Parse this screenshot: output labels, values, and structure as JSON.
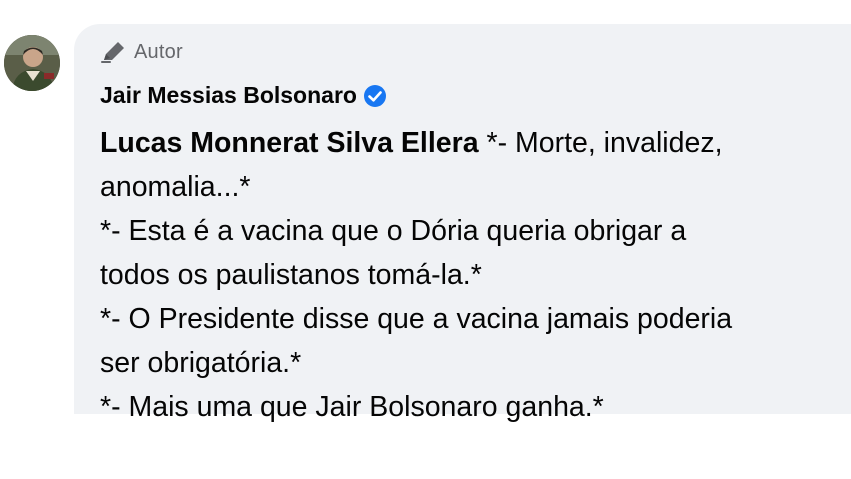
{
  "avatar": {
    "icon": "profile-photo"
  },
  "badge": {
    "label": "Autor",
    "icon": "pen-icon"
  },
  "author": {
    "name": "Jair Messias Bolsonaro",
    "verified": true,
    "verified_color": "#1877f2"
  },
  "comment": {
    "mention": "Lucas Monnerat Silva Ellera",
    "lines": [
      " *- Morte, invalidez,",
      "anomalia...*",
      "*- Esta é a vacina que o Dória queria obrigar a",
      "todos os paulistanos tomá-la.*",
      "*- O Presidente disse que a vacina jamais poderia",
      "ser obrigatória.*",
      "*- Mais uma que Jair Bolsonaro ganha.*"
    ]
  },
  "colors": {
    "bubble": "#f0f2f5",
    "text": "#050505",
    "muted": "#65676b"
  }
}
